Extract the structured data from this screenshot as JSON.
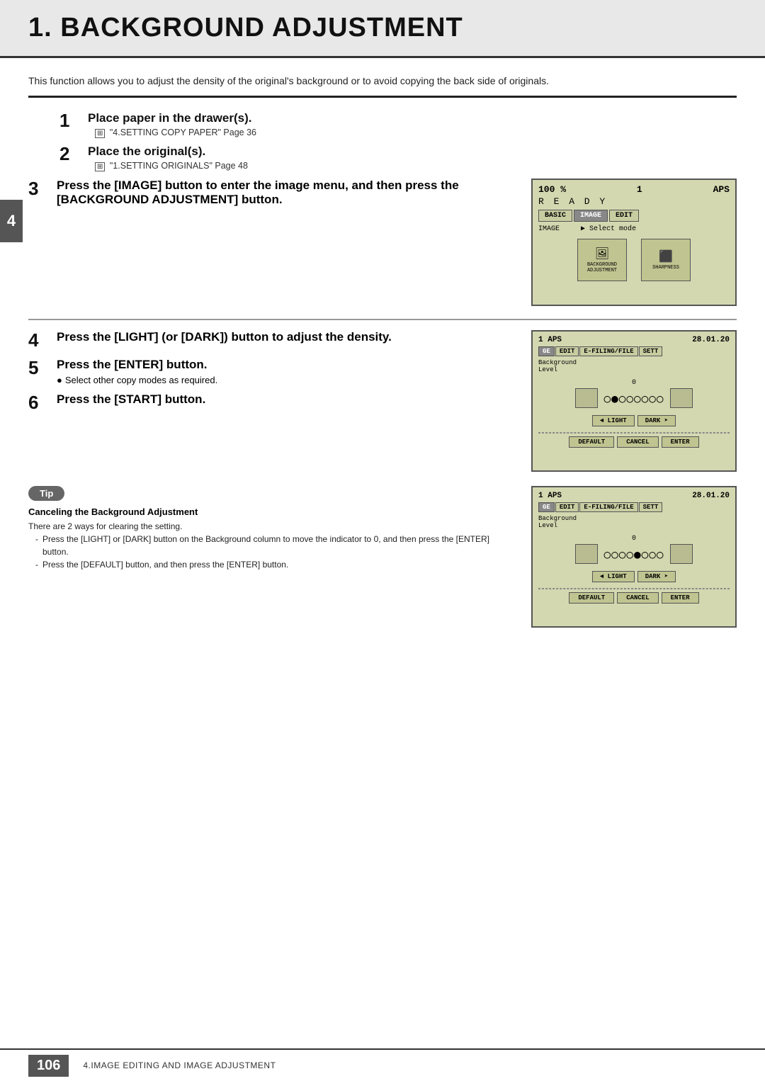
{
  "page": {
    "title": "1. BACKGROUND ADJUSTMENT",
    "intro": "This function allows you to adjust the density of the original's background or to avoid copying the back side of originals."
  },
  "steps": [
    {
      "number": "1",
      "title": "Place paper in the drawer(s).",
      "ref": "\"4.SETTING COPY PAPER\"",
      "ref_page": "Page 36"
    },
    {
      "number": "2",
      "title": "Place the original(s).",
      "ref": "\"1.SETTING ORIGINALS\"",
      "ref_page": "Page 48"
    },
    {
      "number": "3",
      "title": "Press the [IMAGE] button to enter the image menu, and then press the [BACKGROUND ADJUSTMENT] button."
    },
    {
      "number": "4",
      "title": "Press the [LIGHT] (or [DARK]) button to adjust the density."
    },
    {
      "number": "5",
      "title": "Press the [ENTER] button.",
      "bullet": "Select other copy modes as required."
    },
    {
      "number": "6",
      "title": "Press the [START] button."
    }
  ],
  "side_tab": "4",
  "lcd1": {
    "percent": "100 %",
    "copies": "1",
    "aps": "APS",
    "ready": "R E A D Y",
    "tabs": [
      "BASIC",
      "IMAGE",
      "EDIT"
    ],
    "nav": "IMAGE",
    "nav_mode": "▶ Select mode",
    "icon1_label": "BACKGROUND\nADJUSTMENT",
    "icon2_label": "SHARPNESS"
  },
  "lcd2": {
    "copies": "1",
    "aps": "APS",
    "date": "28.01.20",
    "tabs": [
      "GE",
      "EDIT",
      "E-FILING/FILE",
      "SETT"
    ],
    "label": "Background\nLevel",
    "zero": "0",
    "dots_pattern": "○●○○○○○○",
    "light_btn": "◄ LIGHT",
    "dark_btn": "DARK ➤",
    "bottom_btns": [
      "DEFAULT",
      "CANCEL",
      "ENTER"
    ]
  },
  "lcd3": {
    "copies": "1",
    "aps": "APS",
    "date": "28.01.20",
    "tabs": [
      "GE",
      "EDIT",
      "E-FILING/FILE",
      "SETT"
    ],
    "label": "Background\nLevel",
    "zero": "0",
    "dots_pattern": "○○○○●○○○",
    "light_btn": "◄ LIGHT",
    "dark_btn": "DARK ➤",
    "bottom_btns": [
      "DEFAULT",
      "CANCEL",
      "ENTER"
    ]
  },
  "tip": {
    "badge": "Tip",
    "title": "Canceling the Background Adjustment",
    "intro": "There are 2 ways for clearing the setting.",
    "items": [
      "Press the [LIGHT] or [DARK] button on the Background column to move the indicator to 0, and then press the [ENTER] button.",
      "Press the [DEFAULT] button, and then press the [ENTER] button."
    ]
  },
  "footer": {
    "page_number": "106",
    "text": "4.IMAGE EDITING AND IMAGE ADJUSTMENT"
  }
}
